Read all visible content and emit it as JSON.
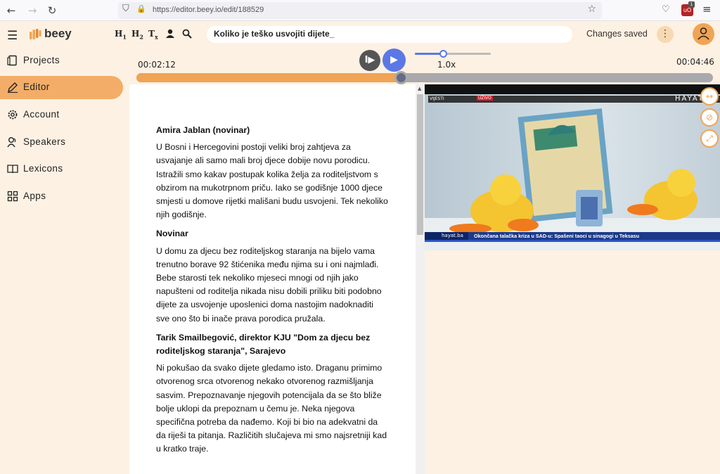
{
  "browser": {
    "url": "https://editor.beey.io/edit/188529",
    "extension_label": "uO",
    "extension_badge": "1"
  },
  "app": {
    "logo_text": "beey",
    "document_title": "Koliko je teško usvojiti dijete_",
    "save_status": "Changes saved",
    "toolbar": {
      "h1": "H",
      "h1_sub": "1",
      "h2": "H",
      "h2_sub": "2",
      "clear": "T",
      "clear_sub": "x"
    }
  },
  "sidebar": {
    "items": [
      {
        "label": "Projects",
        "icon": "projects-icon"
      },
      {
        "label": "Editor",
        "icon": "pencil-icon",
        "active": true
      },
      {
        "label": "Account",
        "icon": "gear-icon"
      },
      {
        "label": "Speakers",
        "icon": "speakers-icon"
      },
      {
        "label": "Lexicons",
        "icon": "book-icon"
      },
      {
        "label": "Apps",
        "icon": "apps-icon"
      }
    ]
  },
  "player": {
    "current_time": "00:02:12",
    "total_time": "00:04:46",
    "speed": "1.0x",
    "progress": 0.46,
    "speed_level": 0.375
  },
  "transcript": [
    {
      "speaker": "Amira Jablan (novinar)",
      "text": "U Bosni i Hercegovini postoji veliki broj zahtjeva za usvajanje ali samo mali broj djece dobije novu porodicu. Istražili smo kakav postupak kolika želja za roditeljstvom s obzirom na mukotrpnom priču. Iako se godišnje 1000 djece smjesti u domove rijetki mališani budu usvojeni. Tek nekoliko njih godišnje."
    },
    {
      "speaker": "Novinar",
      "text": "U domu za djecu bez roditeljskog staranja na bijelo vama trenutno borave 92 štićenika među njima su i oni najmlađi. Bebe starosti tek nekoliko mjeseci mnogi od njih jako napušteni od roditelja nikada nisu dobili priliku biti podobno dijete za usvojenje uposlenici doma nastojim nadoknaditi sve ono što bi inače prava porodica pružala."
    },
    {
      "speaker": "Tarik Smailbegović, direktor KJU \"Dom za djecu bez roditeljskog staranja\", Sarajevo",
      "text": "Ni pokušao da svako dijete gledamo isto. Draganu primimo otvorenog srca otvorenog nekako otvorenog razmišljanja sasvim. Prepoznavanje njegovih potencijala da se što bliže bolje uklopi da prepoznam u čemu je. Neka njegova specifična potreba da nađemo. Koji bi bio na adekvatni da da riješi ta pitanja. Različitih slučajeva mi smo najsretniji kad u kratko traje."
    }
  ],
  "video": {
    "channel_logo": "HAYAT",
    "live_label_1": "VIJESTI",
    "live_label_2": "UŽIVO",
    "source_label": "hayat.ba",
    "ticker": "Okončana talačka kriza u SAD-u: Spašeni taoci u sinagogi u Teksasu"
  },
  "colors": {
    "accent": "#f0a454",
    "sidebar_active": "#f3ad68",
    "play_blue": "#5b78e6",
    "background": "#fdf1e3"
  }
}
